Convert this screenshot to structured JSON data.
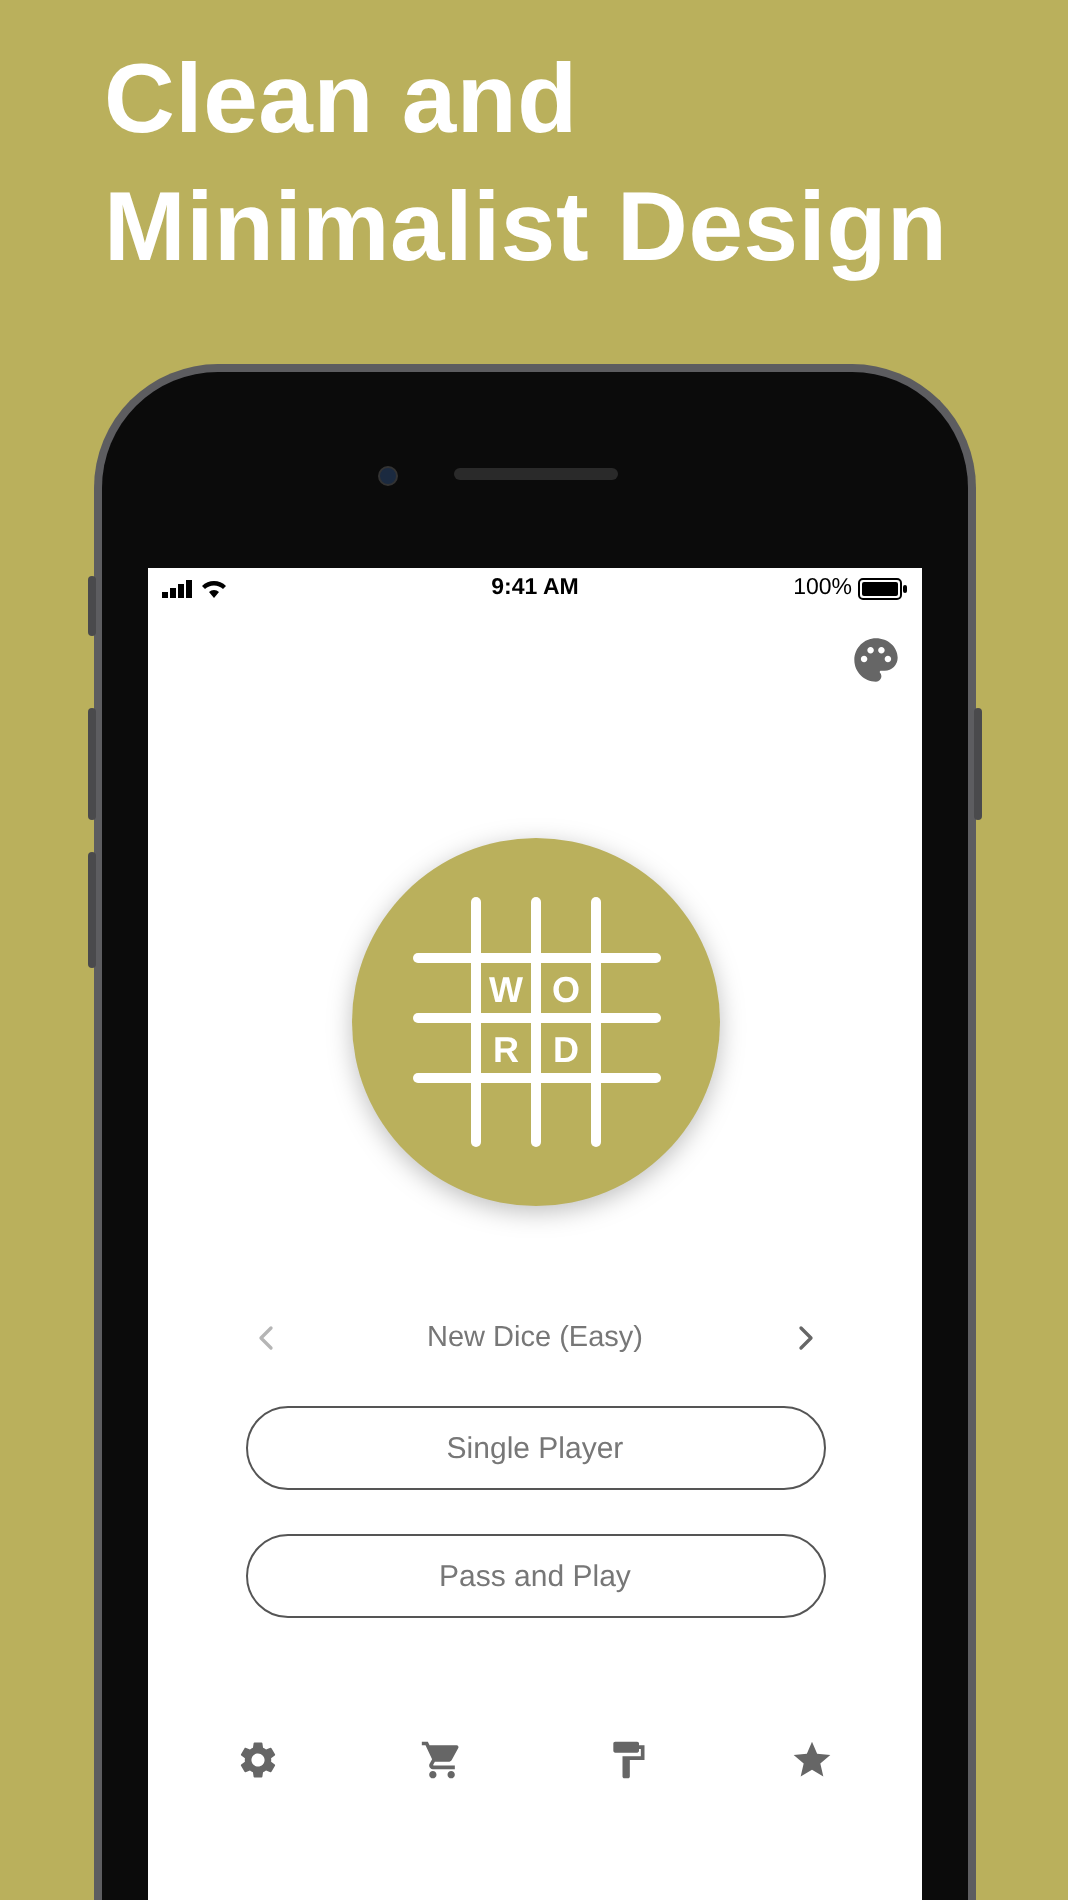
{
  "headline": "Clean and Minimalist Design",
  "status_bar": {
    "time": "9:41 AM",
    "battery": "100%"
  },
  "logo": {
    "letters": [
      "W",
      "O",
      "R",
      "D"
    ]
  },
  "mode_selector": {
    "label": "New Dice (Easy)",
    "previous_disabled": true,
    "next_disabled": false
  },
  "buttons": [
    "Single Player",
    "Pass and Play"
  ],
  "bottom_bar": [
    {
      "kind": "settings"
    },
    {
      "kind": "cart"
    },
    {
      "kind": "paint"
    },
    {
      "kind": "star"
    }
  ]
}
